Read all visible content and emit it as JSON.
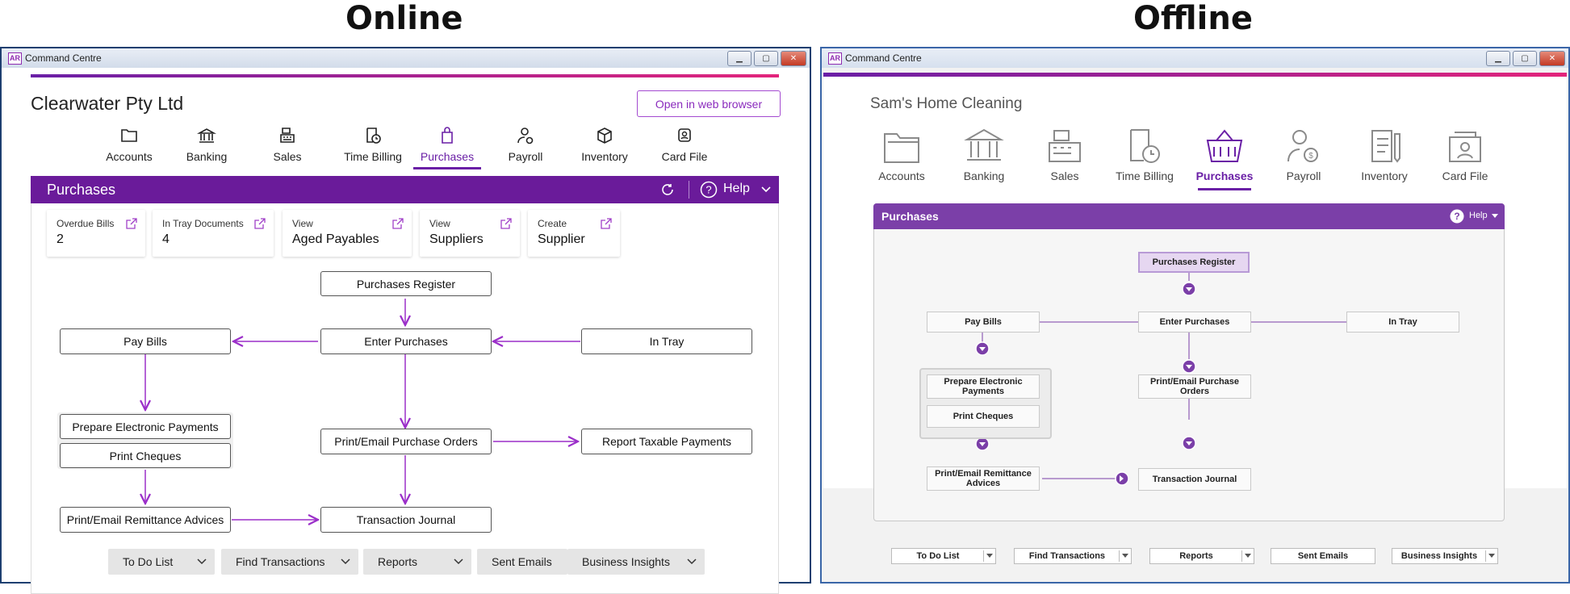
{
  "labels": {
    "online": "Online",
    "offline": "Offline"
  },
  "online": {
    "window_title": "Command Centre",
    "logo_text": "AR",
    "company": "Clearwater Pty Ltd",
    "web_button": "Open in web browser",
    "nav": [
      {
        "label": "Accounts",
        "icon": "folder-icon"
      },
      {
        "label": "Banking",
        "icon": "bank-icon"
      },
      {
        "label": "Sales",
        "icon": "cash-register-icon"
      },
      {
        "label": "Time Billing",
        "icon": "timesheet-icon"
      },
      {
        "label": "Purchases",
        "icon": "shopping-bag-icon",
        "active": true
      },
      {
        "label": "Payroll",
        "icon": "person-money-icon"
      },
      {
        "label": "Inventory",
        "icon": "box-icon"
      },
      {
        "label": "Card File",
        "icon": "card-file-icon"
      }
    ],
    "section_title": "Purchases",
    "help": "Help",
    "cards": [
      {
        "label": "Overdue Bills",
        "value": "2"
      },
      {
        "label": "In Tray Documents",
        "value": "4"
      },
      {
        "label": "View",
        "value": "Aged Payables"
      },
      {
        "label": "View",
        "value": "Suppliers"
      },
      {
        "label": "Create",
        "value": "Supplier"
      }
    ],
    "flow": {
      "purchases_register": "Purchases Register",
      "enter_purchases": "Enter Purchases",
      "pay_bills": "Pay Bills",
      "in_tray": "In Tray",
      "prepare_payments": "Prepare Electronic Payments",
      "print_cheques": "Print Cheques",
      "print_orders": "Print/Email Purchase Orders",
      "report_taxable": "Report Taxable Payments",
      "remittance": "Print/Email Remittance Advices",
      "journal": "Transaction Journal"
    },
    "bottom": [
      "To Do List",
      "Find Transactions",
      "Reports",
      "Sent Emails",
      "Business Insights"
    ],
    "accent": "#6a1b9a"
  },
  "offline": {
    "window_title": "Command Centre",
    "logo_text": "AR",
    "company": "Sam's Home Cleaning",
    "nav": [
      {
        "label": "Accounts",
        "icon": "folder-icon"
      },
      {
        "label": "Banking",
        "icon": "bank-icon"
      },
      {
        "label": "Sales",
        "icon": "cash-register-icon"
      },
      {
        "label": "Time Billing",
        "icon": "timesheet-icon"
      },
      {
        "label": "Purchases",
        "icon": "basket-icon",
        "active": true
      },
      {
        "label": "Payroll",
        "icon": "person-money-icon"
      },
      {
        "label": "Inventory",
        "icon": "clipboard-icon"
      },
      {
        "label": "Card File",
        "icon": "card-file-icon"
      }
    ],
    "section_title": "Purchases",
    "help": "Help",
    "flow": {
      "purchases_register": "Purchases Register",
      "pay_bills": "Pay Bills",
      "enter_purchases": "Enter Purchases",
      "in_tray": "In Tray",
      "prepare_payments": "Prepare Electronic Payments",
      "print_cheques": "Print Cheques",
      "print_orders": "Print/Email Purchase Orders",
      "remittance": "Print/Email Remittance Advices",
      "journal": "Transaction Journal"
    },
    "bottom": [
      "To Do List",
      "Find Transactions",
      "Reports",
      "Sent Emails",
      "Business Insights"
    ],
    "accent": "#7b3fa8"
  }
}
